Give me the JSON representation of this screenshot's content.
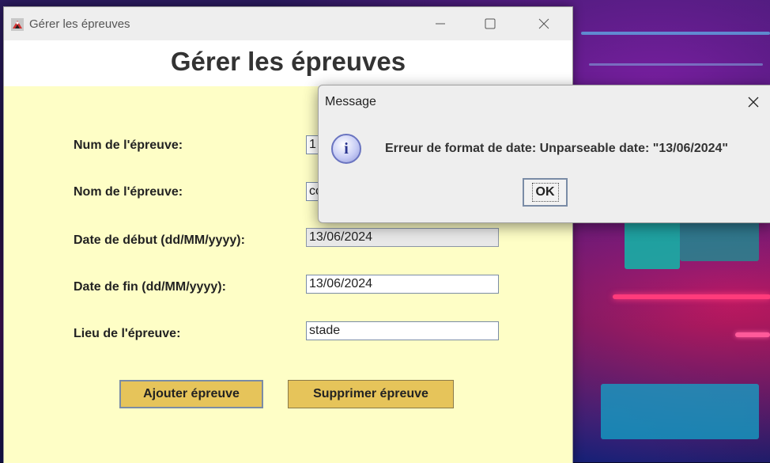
{
  "window": {
    "title": "Gérer les épreuves",
    "icon": "java-app-icon"
  },
  "page": {
    "title": "Gérer les épreuves"
  },
  "form": {
    "num": {
      "label": "Num de l'épreuve:",
      "value": "1"
    },
    "nom": {
      "label": "Nom de l'épreuve:",
      "value": "co"
    },
    "date_debut": {
      "label": "Date de début (dd/MM/yyyy):",
      "value": "13/06/2024"
    },
    "date_fin": {
      "label": "Date de fin (dd/MM/yyyy):",
      "value": "13/06/2024"
    },
    "lieu": {
      "label": "Lieu de l'épreuve:",
      "value": "stade"
    }
  },
  "buttons": {
    "add_label": "Ajouter épreuve",
    "delete_label": "Supprimer épreuve"
  },
  "dialog": {
    "title": "Message",
    "icon": "info-icon",
    "message": "Erreur de format de date: Unparseable date: \"13/06/2024\"",
    "ok_label": "OK"
  },
  "colors": {
    "form_background": "#fefec6",
    "button_background": "#e6c45a",
    "dialog_background": "#eeeeee"
  }
}
